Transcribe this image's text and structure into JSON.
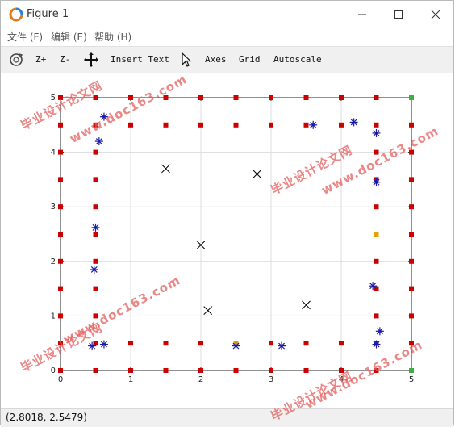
{
  "window": {
    "title": "Figure 1"
  },
  "menu": {
    "items": [
      "文件 (F)",
      "编辑 (E)",
      "帮助 (H)"
    ]
  },
  "toolbar": {
    "zoom_in": "Z+",
    "zoom_out": "Z-",
    "insert_text": "Insert Text",
    "axes": "Axes",
    "grid": "Grid",
    "autoscale": "Autoscale"
  },
  "status": {
    "coords": "(2.8018, 2.5479)"
  },
  "watermarks": [
    "毕业设计论文网",
    "www.doc163.com"
  ],
  "colors": {
    "red_marker": "#cc0000",
    "orange_marker": "#e8a000",
    "green_marker": "#3cb043",
    "star_marker": "#1a1aa8",
    "x_marker": "#000000"
  },
  "chart_data": {
    "type": "scatter",
    "xlim": [
      0,
      5
    ],
    "ylim": [
      0,
      5
    ],
    "xticks": [
      "0",
      "1",
      "2",
      "3",
      "4",
      "5"
    ],
    "yticks": [
      "0",
      "1",
      "2",
      "3",
      "4",
      "5"
    ],
    "grid": true,
    "series": [
      {
        "marker": "square",
        "color": "#cc0000",
        "points": [
          [
            0,
            0
          ],
          [
            0.5,
            0
          ],
          [
            1,
            0
          ],
          [
            1.5,
            0
          ],
          [
            2,
            0
          ],
          [
            2.5,
            0
          ],
          [
            3,
            0
          ],
          [
            3.5,
            0
          ],
          [
            4,
            0
          ],
          [
            4.5,
            0
          ],
          [
            5,
            0
          ],
          [
            0,
            5
          ],
          [
            0.5,
            5
          ],
          [
            1,
            5
          ],
          [
            1.5,
            5
          ],
          [
            2,
            5
          ],
          [
            2.5,
            5
          ],
          [
            3,
            5
          ],
          [
            3.5,
            5
          ],
          [
            4,
            5
          ],
          [
            4.5,
            5
          ],
          [
            5,
            5
          ],
          [
            0,
            0.5
          ],
          [
            0,
            1
          ],
          [
            0,
            1.5
          ],
          [
            0,
            2
          ],
          [
            0,
            2.5
          ],
          [
            0,
            3
          ],
          [
            0,
            3.5
          ],
          [
            0,
            4
          ],
          [
            0,
            4.5
          ],
          [
            5,
            0.5
          ],
          [
            5,
            1
          ],
          [
            5,
            1.5
          ],
          [
            5,
            2
          ],
          [
            5,
            2.5
          ],
          [
            5,
            3
          ],
          [
            5,
            3.5
          ],
          [
            5,
            4
          ],
          [
            5,
            4.5
          ],
          [
            0.5,
            0.5
          ],
          [
            1,
            0.5
          ],
          [
            1.5,
            0.5
          ],
          [
            2,
            0.5
          ],
          [
            2.5,
            0.5
          ],
          [
            3,
            0.5
          ],
          [
            3.5,
            0.5
          ],
          [
            4,
            0.5
          ],
          [
            4.5,
            0.5
          ],
          [
            0.5,
            4.5
          ],
          [
            1,
            4.5
          ],
          [
            1.5,
            4.5
          ],
          [
            2,
            4.5
          ],
          [
            2.5,
            4.5
          ],
          [
            3,
            4.5
          ],
          [
            3.5,
            4.5
          ],
          [
            4,
            4.5
          ],
          [
            4.5,
            4.5
          ],
          [
            0.5,
            1
          ],
          [
            0.5,
            1.5
          ],
          [
            0.5,
            2
          ],
          [
            0.5,
            2.5
          ],
          [
            0.5,
            3
          ],
          [
            0.5,
            3.5
          ],
          [
            0.5,
            4
          ],
          [
            4.5,
            1
          ],
          [
            4.5,
            1.5
          ],
          [
            4.5,
            2
          ],
          [
            4.5,
            2.5
          ],
          [
            4.5,
            3
          ],
          [
            4.5,
            3.5
          ],
          [
            4.5,
            4
          ]
        ]
      },
      {
        "marker": "star",
        "color": "#1a1aa8",
        "points": [
          [
            0.62,
            4.65
          ],
          [
            0.55,
            4.2
          ],
          [
            0.5,
            2.62
          ],
          [
            0.48,
            1.85
          ],
          [
            0.45,
            0.45
          ],
          [
            0.62,
            0.48
          ],
          [
            2.5,
            0.45
          ],
          [
            3.15,
            0.45
          ],
          [
            3.6,
            4.5
          ],
          [
            4.18,
            4.55
          ],
          [
            4.5,
            4.35
          ],
          [
            4.5,
            3.45
          ],
          [
            4.45,
            1.55
          ],
          [
            4.55,
            0.72
          ],
          [
            4.5,
            0.48
          ]
        ]
      },
      {
        "marker": "x",
        "color": "#000000",
        "points": [
          [
            1.5,
            3.7
          ],
          [
            2.8,
            3.6
          ],
          [
            2,
            2.3
          ],
          [
            2.1,
            1.1
          ],
          [
            3.5,
            1.2
          ]
        ]
      }
    ]
  }
}
